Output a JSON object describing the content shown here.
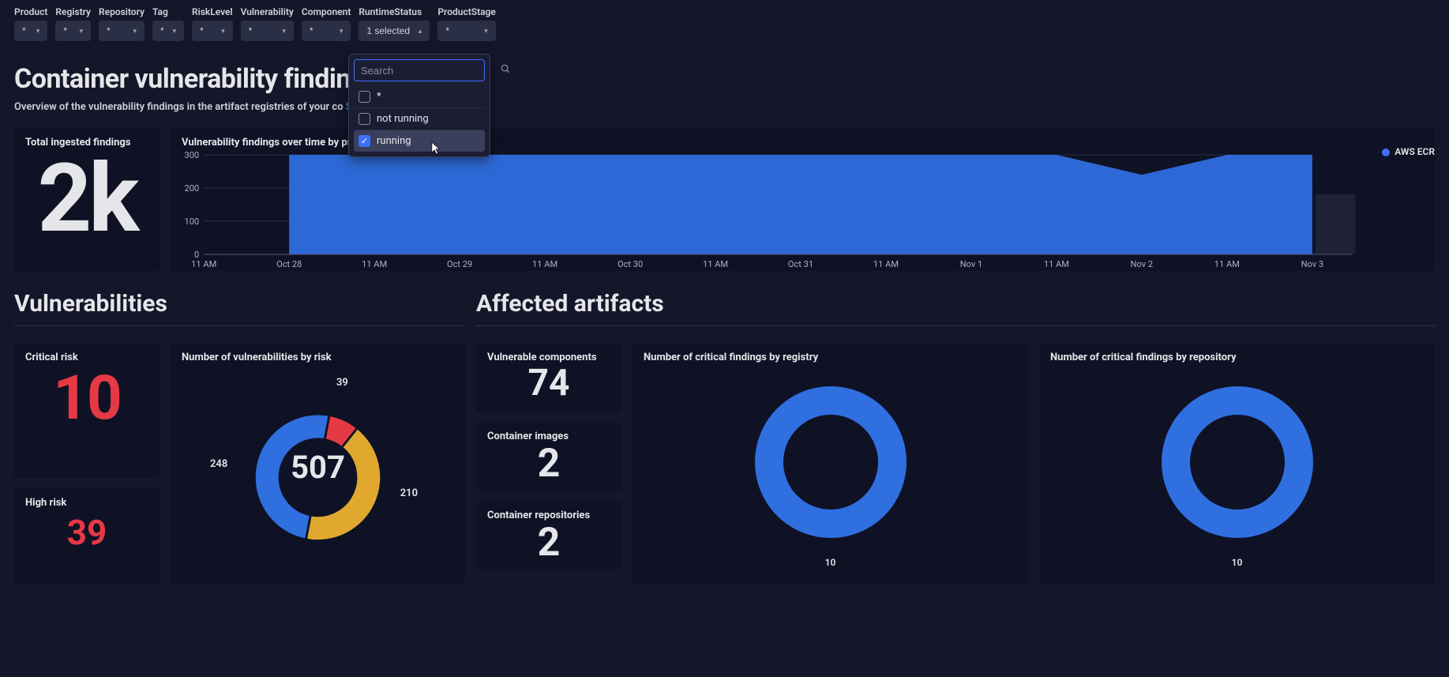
{
  "filters": [
    {
      "label": "Product",
      "value": "*"
    },
    {
      "label": "Registry",
      "value": "*"
    },
    {
      "label": "Repository",
      "value": "*"
    },
    {
      "label": "Tag",
      "value": "*"
    },
    {
      "label": "RiskLevel",
      "value": "*"
    },
    {
      "label": "Vulnerability",
      "value": "*"
    },
    {
      "label": "Component",
      "value": "*"
    },
    {
      "label": "RuntimeStatus",
      "value": "1 selected"
    },
    {
      "label": "ProductStage",
      "value": "*"
    }
  ],
  "dropdown": {
    "search_placeholder": "Search",
    "options": [
      {
        "label": "*",
        "checked": false
      },
      {
        "label": "not running",
        "checked": false
      },
      {
        "label": "running",
        "checked": true
      }
    ]
  },
  "header": {
    "title": "Container vulnerability findings",
    "desc_prefix": "Overview of the vulnerability findings in the artifact registries of your co",
    "link_text": "Security events ingest",
    "desc_suffix": "."
  },
  "panels": {
    "total": {
      "title": "Total ingested findings",
      "value": "2k"
    },
    "overtime": {
      "title": "Vulnerability findings over time by provider product",
      "legend": "AWS ECR"
    },
    "vulnerabilities_title": "Vulnerabilities",
    "affected_title": "Affected artifacts",
    "critical": {
      "title": "Critical risk",
      "value": "10"
    },
    "high": {
      "title": "High risk",
      "value": "39"
    },
    "by_risk": {
      "title": "Number of vulnerabilities by risk",
      "center": "507",
      "l1": "248",
      "l2": "39",
      "l3": "210"
    },
    "vuln_comp": {
      "title": "Vulnerable components",
      "value": "74"
    },
    "images": {
      "title": "Container images",
      "value": "2"
    },
    "repos": {
      "title": "Container repositories",
      "value": "2"
    },
    "by_registry": {
      "title": "Number of critical findings by registry",
      "label": "10"
    },
    "by_repository": {
      "title": "Number of critical findings by repository",
      "label": "10"
    }
  },
  "chart_data": {
    "type": "area",
    "title": "Vulnerability findings over time by provider product",
    "ylabel": "",
    "ylim": [
      0,
      300
    ],
    "yticks": [
      0,
      100,
      200,
      300
    ],
    "x_labels": [
      "11 AM",
      "Oct 28",
      "11 AM",
      "Oct 29",
      "11 AM",
      "Oct 30",
      "11 AM",
      "Oct 31",
      "11 AM",
      "Nov 1",
      "11 AM",
      "Nov 2",
      "11 AM",
      "Nov 3"
    ],
    "series": [
      {
        "name": "AWS ECR",
        "values": [
          300,
          300,
          300,
          300,
          300,
          300,
          300,
          300,
          300,
          300,
          300,
          240,
          300,
          300
        ]
      }
    ],
    "start_index": 1
  },
  "donut_data": {
    "type": "pie",
    "title": "Number of vulnerabilities by risk",
    "total": 507,
    "slices": [
      {
        "label": "248",
        "value": 248,
        "color": "#2f6fe0"
      },
      {
        "label": "39",
        "value": 39,
        "color": "#e63946"
      },
      {
        "label": "210",
        "value": 210,
        "color": "#e0a82f"
      }
    ]
  }
}
